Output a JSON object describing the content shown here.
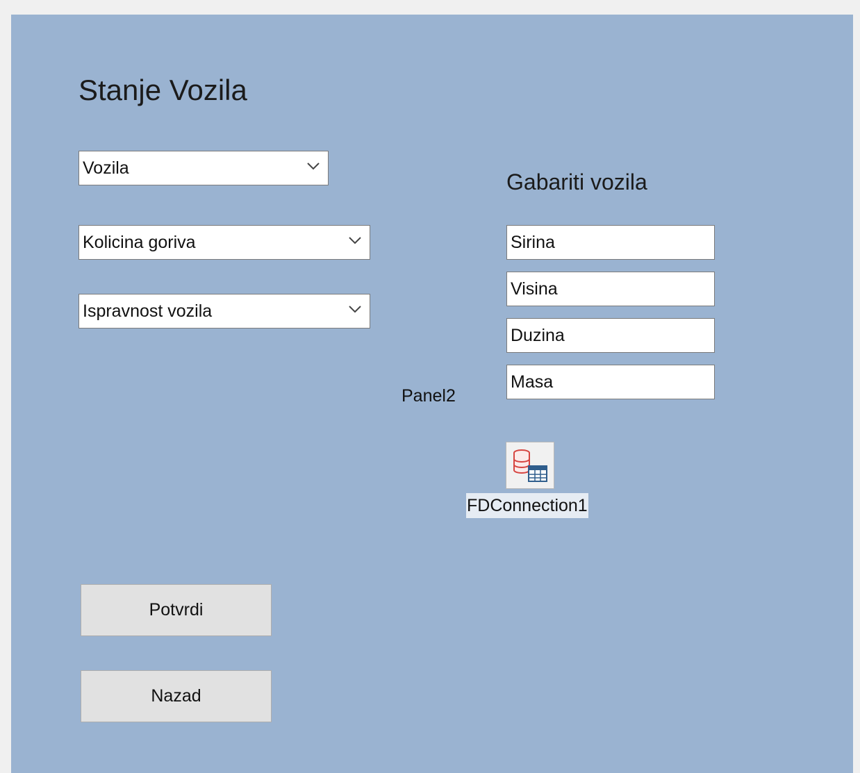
{
  "form": {
    "title": "Stanje Vozila"
  },
  "combos": [
    {
      "value": "Vozila",
      "icon": "chevron-down-icon"
    },
    {
      "value": "Kolicina goriva",
      "icon": "chevron-down-icon"
    },
    {
      "value": "Ispravnost vozila",
      "icon": "chevron-down-icon"
    }
  ],
  "dimensions": {
    "title": "Gabariti vozila",
    "fields": [
      {
        "value": "Sirina"
      },
      {
        "value": "Visina"
      },
      {
        "value": "Duzina"
      },
      {
        "value": "Masa"
      }
    ]
  },
  "panel": {
    "caption": "Panel2"
  },
  "component": {
    "label": "FDConnection1",
    "icon": "database-connection-icon"
  },
  "buttons": {
    "confirm": "Potvrdi",
    "back": "Nazad"
  },
  "colors": {
    "form_background": "#9ab3d1",
    "button_face": "#e1e1e1"
  }
}
